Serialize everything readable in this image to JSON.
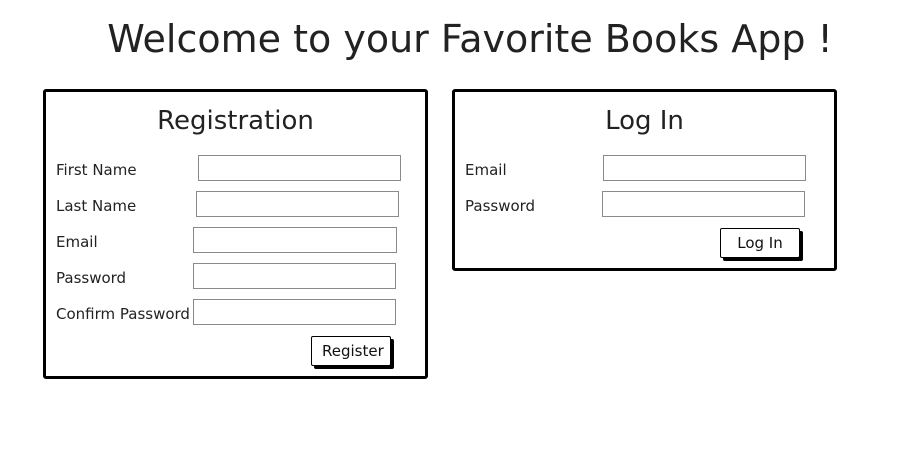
{
  "header": {
    "title": "Welcome to your Favorite Books App !"
  },
  "registration": {
    "title": "Registration",
    "fields": [
      {
        "label": "First Name",
        "value": ""
      },
      {
        "label": "Last Name",
        "value": ""
      },
      {
        "label": "Email",
        "value": ""
      },
      {
        "label": "Password",
        "value": ""
      },
      {
        "label": "Confirm Password",
        "value": ""
      }
    ],
    "submit_label": "Register"
  },
  "login": {
    "title": "Log In",
    "fields": [
      {
        "label": "Email",
        "value": ""
      },
      {
        "label": "Password",
        "value": ""
      }
    ],
    "submit_label": "Log In"
  }
}
